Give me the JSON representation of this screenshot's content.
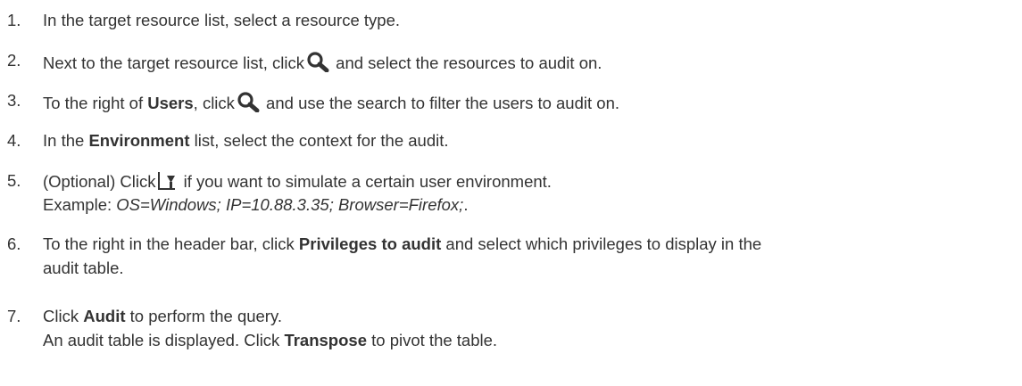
{
  "steps": [
    {
      "num": "1.",
      "text": "In the target resource list, select a resource type."
    },
    {
      "num": "2.",
      "pre": "Next to the target resource list, click",
      "icon": "search-icon",
      "post": " and select the resources to audit on."
    },
    {
      "num": "3.",
      "pre": "To the right of ",
      "bold": "Users",
      "mid": ", click",
      "icon": "search-icon",
      "post": " and use the search to filter the users to audit on."
    },
    {
      "num": "4.",
      "pre": "In the ",
      "bold": "Environment",
      "post": " list, select the context for the audit."
    },
    {
      "num": "5.",
      "pre": "(Optional) Click",
      "icon": "add-environment-dropdown-icon",
      "post": " if you want to simulate a certain user environment.",
      "line2_label": "Example: ",
      "line2_italic": "OS=Windows; IP=10.88.3.35; Browser=Firefox;",
      "line2_end": "."
    },
    {
      "num": "6.",
      "pre": "To the right in the header bar, click ",
      "bold": "Privileges to audit",
      "post": " and select which privileges to display in the",
      "line2": "audit table."
    },
    {
      "num": "7.",
      "pre": "Click ",
      "bold": "Audit",
      "post": " to perform the query.",
      "line2_pre": "An audit table is displayed. Click ",
      "line2_bold": "Transpose",
      "line2_post": " to pivot the table."
    }
  ]
}
